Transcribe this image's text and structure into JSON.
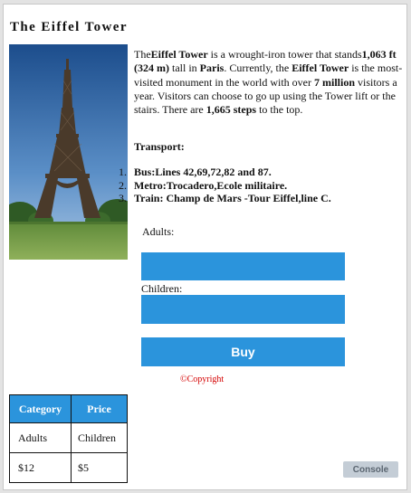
{
  "page": {
    "title": "The Eiffel Tower"
  },
  "photo": {
    "icon": "eiffel-tower-photo"
  },
  "description": {
    "p1": "The",
    "b1": "Eiffel Tower",
    "p2": " is a wrought-iron tower that stands",
    "b2": "1,063 ft (324 m)",
    "p3": " tall in ",
    "b3": "Paris",
    "p4": ". Currently, the ",
    "b4": "Eiffel Tower",
    "p5": " is the most-visited monument in the world with over ",
    "b5": "7 million",
    "p6": " visitors a year. Visitors can choose to go up using the Tower lift or the stairs. There are ",
    "b6": "1,665 steps",
    "p7": " to the top."
  },
  "transport": {
    "heading": "Transport:",
    "items": [
      {
        "num": "1.",
        "text": "Bus:Lines 42,69,72,82 and 87."
      },
      {
        "num": "2.",
        "text": "Metro:Trocadero,Ecole militaire."
      },
      {
        "num": "3.",
        "text": "Train: Champ de Mars -Tour Eiffel,line C."
      }
    ]
  },
  "form": {
    "adults_label": "Adults:",
    "children_label": "Children:",
    "adults_value": "",
    "children_value": "",
    "buy_label": "Buy"
  },
  "copyright": "©Copyright",
  "prices_table": {
    "headers": [
      "Category",
      "Price"
    ],
    "rows": [
      [
        "Adults",
        "Children"
      ],
      [
        "$12",
        "$5"
      ]
    ]
  },
  "console_label": "Console",
  "colors": {
    "accent": "#2b94dc",
    "copyright": "#d40000"
  }
}
